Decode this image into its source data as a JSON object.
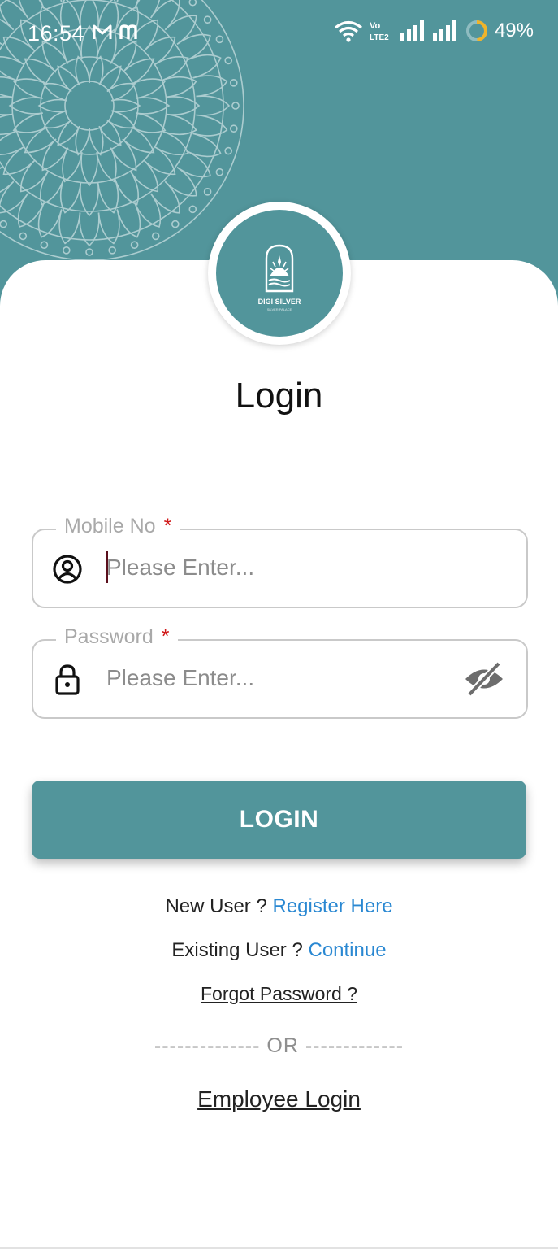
{
  "colors": {
    "primary": "#52959b",
    "link": "#2a88d2",
    "required": "#d01818",
    "battery_ring": "#f0b429"
  },
  "status_bar": {
    "time": "16:54",
    "left_icons": [
      "gmail-icon",
      "m-app-icon"
    ],
    "right_icons": [
      "wifi-icon",
      "volte-icon",
      "signal-icon",
      "signal-icon",
      "battery-ring-icon"
    ],
    "volte_text": [
      "Vo",
      "LTE2"
    ],
    "battery": "49%",
    "battery_level": 0.49
  },
  "logo": {
    "brand": "DIGI SILVER",
    "sub": "SILVER PALACE"
  },
  "title": "Login",
  "form": {
    "mobile": {
      "label": "Mobile No",
      "required_mark": "*",
      "placeholder": "Please Enter...",
      "icon": "user-circle-icon"
    },
    "password": {
      "label": "Password",
      "required_mark": "*",
      "placeholder": "Please Enter...",
      "icon": "lock-icon",
      "toggle_icon": "eye-off-icon"
    }
  },
  "login_button": "LOGIN",
  "links": {
    "new_user_text": "New User ? ",
    "register": "Register Here",
    "existing_user_text": "Existing User ? ",
    "continue": "Continue",
    "forgot": "Forgot Password ?",
    "divider": "-------------- OR -------------",
    "employee": "Employee Login"
  }
}
